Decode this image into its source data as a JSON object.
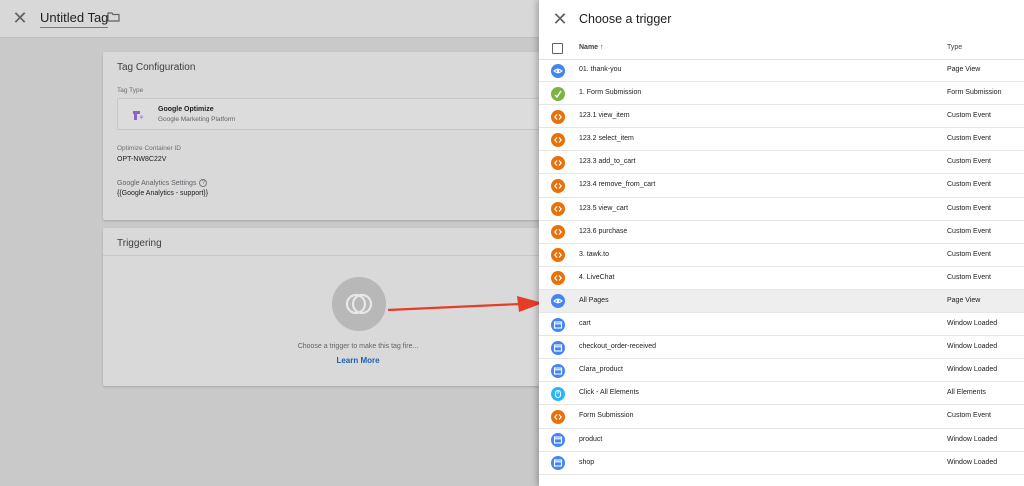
{
  "editor": {
    "title": "Untitled Tag",
    "config_card": {
      "title": "Tag Configuration",
      "tag_type_label": "Tag Type",
      "tag_type_name": "Google Optimize",
      "tag_type_sub": "Google Marketing Platform",
      "container_id_label": "Optimize Container ID",
      "container_id_value": "OPT-NW8C22V",
      "ga_settings_label": "Google Analytics Settings",
      "ga_settings_value": "{{Google Analytics - support}}"
    },
    "trigger_card": {
      "title": "Triggering",
      "hint": "Choose a trigger to make this tag fire...",
      "learn_more": "Learn More"
    }
  },
  "panel": {
    "title": "Choose a trigger",
    "col_name": "Name ↑",
    "col_type": "Type",
    "rows": [
      {
        "name": "01. thank-you",
        "type": "Page View",
        "icon": "page-view-icon",
        "color": "#4285f4"
      },
      {
        "name": "1. Form Submission",
        "type": "Form Submission",
        "icon": "form-submission-icon",
        "color": "#7cb342"
      },
      {
        "name": "123.1 view_item",
        "type": "Custom Event",
        "icon": "custom-event-icon",
        "color": "#e8710a"
      },
      {
        "name": "123.2 select_item",
        "type": "Custom Event",
        "icon": "custom-event-icon",
        "color": "#e8710a"
      },
      {
        "name": "123.3 add_to_cart",
        "type": "Custom Event",
        "icon": "custom-event-icon",
        "color": "#e8710a"
      },
      {
        "name": "123.4 remove_from_cart",
        "type": "Custom Event",
        "icon": "custom-event-icon",
        "color": "#e8710a"
      },
      {
        "name": "123.5 view_cart",
        "type": "Custom Event",
        "icon": "custom-event-icon",
        "color": "#e8710a"
      },
      {
        "name": "123.6 purchase",
        "type": "Custom Event",
        "icon": "custom-event-icon",
        "color": "#e8710a"
      },
      {
        "name": "3. tawk.to",
        "type": "Custom Event",
        "icon": "custom-event-icon",
        "color": "#e8710a"
      },
      {
        "name": "4. LiveChat",
        "type": "Custom Event",
        "icon": "custom-event-icon",
        "color": "#e8710a"
      },
      {
        "name": "All Pages",
        "type": "Page View",
        "icon": "page-view-icon",
        "color": "#4285f4",
        "highlighted": true
      },
      {
        "name": "cart",
        "type": "Window Loaded",
        "icon": "window-loaded-icon",
        "color": "#4285f4"
      },
      {
        "name": "checkout_order-received",
        "type": "Window Loaded",
        "icon": "window-loaded-icon",
        "color": "#4285f4"
      },
      {
        "name": "Clara_product",
        "type": "Window Loaded",
        "icon": "window-loaded-icon",
        "color": "#4285f4"
      },
      {
        "name": "Click - All Elements",
        "type": "All Elements",
        "icon": "click-icon",
        "color": "#29b6f6"
      },
      {
        "name": "Form Submission",
        "type": "Custom Event",
        "icon": "custom-event-icon",
        "color": "#e8710a"
      },
      {
        "name": "product",
        "type": "Window Loaded",
        "icon": "window-loaded-icon",
        "color": "#4285f4"
      },
      {
        "name": "shop",
        "type": "Window Loaded",
        "icon": "window-loaded-icon",
        "color": "#4285f4"
      }
    ]
  }
}
